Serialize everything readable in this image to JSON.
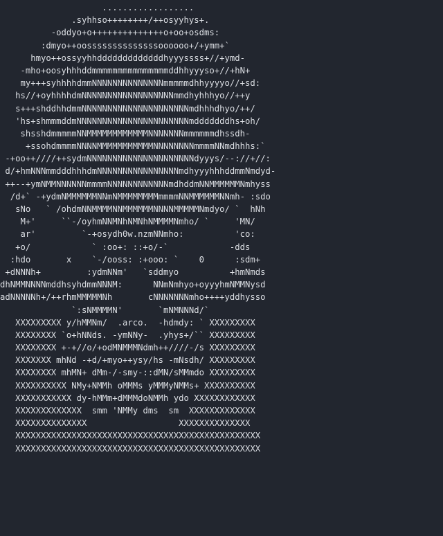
{
  "terminal": {
    "ascii_lines": [
      "                    ..................",
      "              .syhhso++++++++/++osyyhys+.",
      "          -oddyo+o++++++++++++++o+oo+osdms:",
      "        :dmyo++oossssssssssssssoooooo+/+ymm+`",
      "      hmyo++ossyyhhdddddddddddddhyyyssss+//+ymd-",
      "    -mho+oosyhhhddmmmmmmmmmmmmmmmddhhyyyso+//+hN+",
      "    my+++syhhhhdmmNNNNNNNNNNNNNNmmmmmdhhyyyyo//+sd:",
      "   hs//+oyhhhhdmNNNNNNNNNNNNNNNNNNmmdhyhhhyo//++y",
      "   s+++shddhhdmmNNNNNNNNNNNNNNNNNNNNNmdhhhdhyo/++/",
      "   'hs+shmmmddmNNNNNNNNNNNNNNNNNNNNNNmdddddddhs+oh/",
      "    shsshdmmmmmNNMMMMMMMMMMMMNNNNNNNmmmmmmdhssdh-",
      "     +ssohdmmmmNNNNMMMMMMMMMMMNNNNNNNNmmmmNNmdhhhs:`",
      " -+oo++////++sydmNNNNNNNNNNNNNNNNNNNNNdyyys/--://+//:",
      " d/+hmNNNmmdddhhhdmNNNNNNNNNNNNNNNNmdhyyyhhhddmmNmdyd-",
      " ++--+ymNMMNNNNNNmmmmNNNNNNNNNNNNmdhddmNNMMMMMMNmhyss",
      "  /d+` -+ydmNMMMMMMNNmNMMMMMMMMmmmmNNMMMMMMNNmh- :sdo",
      "   sNo   ` /ohdmNNMMMMNNMMMMMMNNNNMMMMMNmdyo/ `  hNh",
      "    M+'     ``-/oyhmNNMNhNMNhNMMMMNmho/ `     'MN/",
      "    ar'         `-+osydh0w.nzmNNmho:          'co:",
      "   +o/            ` :oo+: ::+o/-`            -dds",
      "  :hdo       x    `-/ooss: :+ooo: `    0      :sdm+",
      " +dNNNh+         :ydmNNm'   `sddmyo          +hmNmds",
      "dhNMMNNNNmddhsyhdmmNNNM:      NNmNmhyo+oyyyhmNMMNysd",
      "adNNNNNh+/++rhmMMMMMNh       cNNNNNNNmho++++yddhysso",
      "              `:sNMMMMN'       `mNMNNNd/`",
      "   XXXXXXXXX y/hMMNm/  .arco.  -hdmdy: ` XXXXXXXXX",
      "   XXXXXXXX `o+hNNds. -ymNNy-  .yhys+/`` XXXXXXXXX",
      "   XXXXXXXX +-+//o/+odMNMMMNdmh++////-/s XXXXXXXXX",
      "   XXXXXXX mhNd -+d/+myo++ysy/hs -mNsdh/ XXXXXXXXX",
      "   XXXXXXXX mhMN+ dMm-/-smy-::dMN/sMMmdo XXXXXXXXX",
      "   XXXXXXXXXX NMy+NMMh oMMMs yMMMyNMMs+ XXXXXXXXXX",
      "   XXXXXXXXXXX dy-hMMm+dMMMdoNMMh ydo XXXXXXXXXXXX",
      "   XXXXXXXXXXXXX  smm 'NMMy dms  sm  XXXXXXXXXXXXX",
      "   XXXXXXXXXXXXXX                  XXXXXXXXXXXXXX",
      "   XXXXXXXXXXXXXXXXXXXXXXXXXXXXXXXXXXXXXXXXXXXXXXXX",
      "   XXXXXXXXXXXXXXXXXXXXXXXXXXXXXXXXXXXXXXXXXXXXXXXX"
    ]
  },
  "colors": {
    "background": "#22262f",
    "foreground": "#dcdfe4"
  }
}
